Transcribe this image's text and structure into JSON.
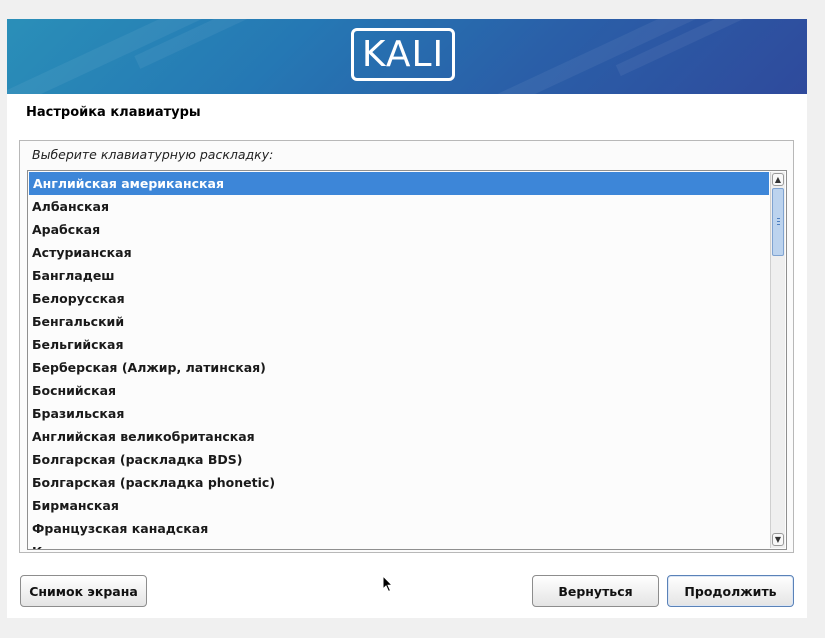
{
  "banner": {
    "logo_text": "KALI",
    "colors": {
      "left": "#2a8fb8",
      "right": "#2f4a9c"
    }
  },
  "page": {
    "title": "Настройка клавиатуры",
    "prompt": "Выберите клавиатурную раскладку:"
  },
  "layouts": {
    "selected_index": 0,
    "items": [
      "Английская американская",
      "Албанская",
      "Арабская",
      "Астурианская",
      "Бангладеш",
      "Белорусская",
      "Бенгальский",
      "Бельгийская",
      "Берберская (Алжир, латинская)",
      "Боснийская",
      "Бразильская",
      "Английская великобританская",
      "Болгарская (раскладка BDS)",
      "Болгарская (раскладка phonetic)",
      "Бирманская",
      "Французская канадская",
      "Канадская многоязычная"
    ]
  },
  "buttons": {
    "screenshot": "Снимок экрана",
    "back": "Вернуться",
    "continue": "Продолжить"
  },
  "accent_color": "#3d86d8"
}
